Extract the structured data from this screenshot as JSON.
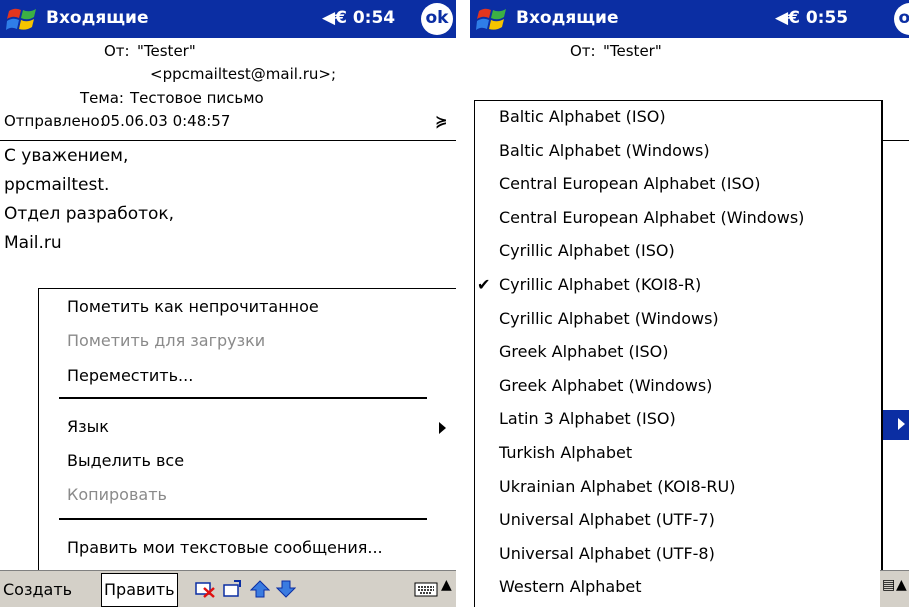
{
  "left": {
    "title": "Входящие",
    "clock": "◀€ 0:54",
    "ok": "ok",
    "header": {
      "from_label": "От:",
      "from_name": "\"Tester\"",
      "from_email": "<ppcmailtest@mail.ru>;",
      "subject_label": "Тема:",
      "subject": "Тестовое письмо",
      "sent_label": "Отправлено:",
      "sent": "05.06.03 0:48:57",
      "expand": "≽"
    },
    "body": [
      "С уважением,",
      "ppcmailtest.",
      "Отдел разработок,",
      "Mail.ru"
    ],
    "menu": {
      "mark_unread": "Пометить как непрочитанное",
      "mark_download": "Пометить для загрузки",
      "move": "Переместить...",
      "language": "Язык",
      "select_all": "Выделить все",
      "copy": "Копировать",
      "edit_messages": "Править мои текстовые сообщения..."
    },
    "bottom": {
      "create": "Создать",
      "edit": "Править",
      "up_arrow": "▲"
    }
  },
  "right": {
    "title": "Входящие",
    "clock": "◀€ 0:55",
    "ok": "ok",
    "from_label": "От:",
    "from_name": "\"Tester\"",
    "check": "✔",
    "encodings": [
      "Baltic Alphabet (ISO)",
      "Baltic Alphabet (Windows)",
      "Central European Alphabet (ISO)",
      "Central European Alphabet (Windows)",
      "Cyrillic Alphabet (ISO)",
      "Cyrillic Alphabet (KOI8-R)",
      "Cyrillic Alphabet (Windows)",
      "Greek Alphabet (ISO)",
      "Greek Alphabet (Windows)",
      "Latin 3 Alphabet (ISO)",
      "Turkish Alphabet",
      "Ukrainian Alphabet (KOI8-RU)",
      "Universal Alphabet (UTF-7)",
      "Universal Alphabet (UTF-8)",
      "Western Alphabet"
    ],
    "selected_index": 5,
    "up_arrow": "▲"
  },
  "colors": {
    "titlebar": "#0b2ea3",
    "highlight": "#0b2ea3",
    "disabled": "#8a8a8a",
    "toolbar": "#d4d0c8"
  }
}
